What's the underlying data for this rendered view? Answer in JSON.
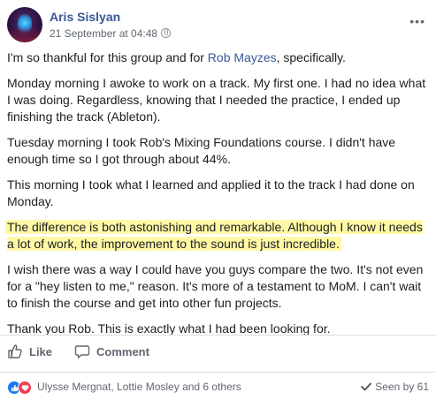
{
  "post": {
    "author": "Aris Sislyan",
    "timestamp": "21 September at 04:48",
    "privacy_icon": "globe-icon",
    "menu_label": "•••",
    "intro_before": "I'm so thankful for this group and for ",
    "intro_link": "Rob Mayzes",
    "intro_after": ", specifically.",
    "paragraph_2": "Monday morning I awoke to work on a track. My first one. I had no idea what I was doing. Regardless, knowing that I needed the practice, I ended up finishing the track (Ableton).",
    "paragraph_3": "Tuesday morning I took Rob's Mixing Foundations course. I didn't have enough time so I got through about 44%.",
    "paragraph_4": "This morning I took what I learned and applied it to the track I had done on Monday.",
    "paragraph_5_highlighted": "The difference is both astonishing and remarkable. Although I know it needs a lot of work, the improvement to the sound is just incredible.",
    "paragraph_6": "I wish there was a way I could have you guys compare the two. It's not even for a \"hey listen to me,\" reason. It's more of a testament to MoM. I can't wait to finish the course and get into other fun projects.",
    "paragraph_7": "Thank you Rob. This is exactly what I had been looking for.",
    "highlight_color": "#fff9a6"
  },
  "actions": {
    "like_label": "Like",
    "comment_label": "Comment"
  },
  "footer": {
    "reacted_by": "Ulysse Mergnat, Lottie Mosley and 6 others",
    "seen_by": "Seen by 61",
    "like_color": "#1877f2",
    "love_color": "#f33e58"
  }
}
